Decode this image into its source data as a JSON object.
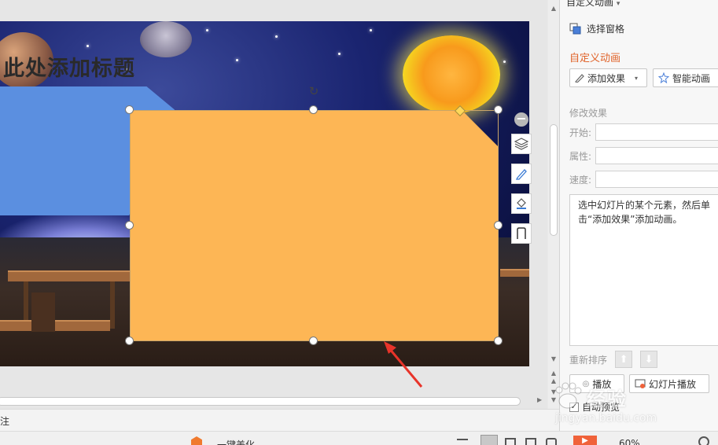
{
  "slide": {
    "title_placeholder": "此处添加标题"
  },
  "notes": {
    "label": "注"
  },
  "status_bar": {
    "beautify": "一键美化",
    "zoom": "60%"
  },
  "panel": {
    "header": "自定义动画",
    "select_pane": "选择窗格",
    "section_title": "自定义动画",
    "add_effect": "添加效果",
    "smart_animation": "智能动画",
    "modify_effect": "修改效果",
    "fields": {
      "start": "开始:",
      "property": "属性:",
      "speed": "速度:"
    },
    "hint": "选中幻灯片的某个元素，然后单击“添加效果”添加动画。",
    "reorder": "重新排序",
    "play": "播放",
    "slideshow": "幻灯片播放",
    "autopreview": "自动预览"
  },
  "watermark": {
    "text": "经验",
    "url": "jingyan.baidu.com"
  },
  "colors": {
    "orange_shape": "#fdb655",
    "blue_shape": "#5b8fe0",
    "accent": "#e0632a"
  }
}
